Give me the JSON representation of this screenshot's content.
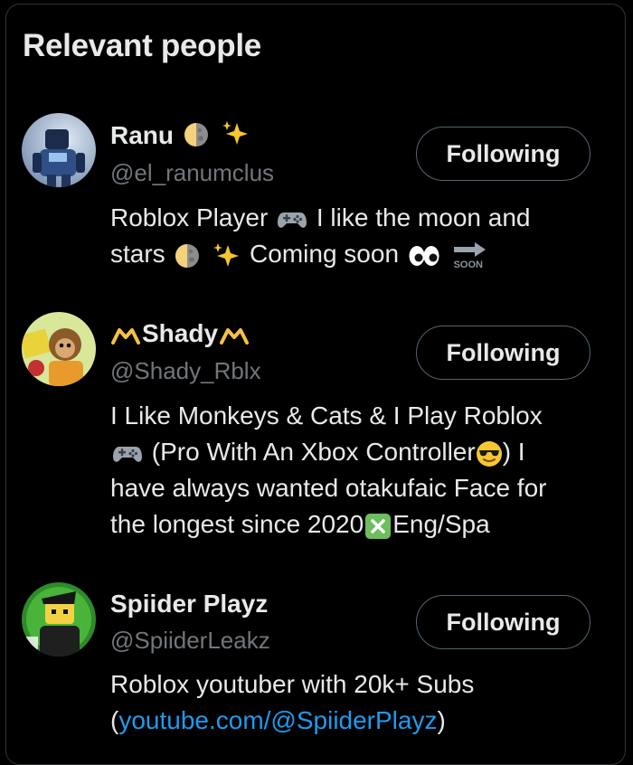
{
  "section_title": "Relevant people",
  "people": [
    {
      "name": "Ranu",
      "handle": "@el_ranumclus",
      "follow_label": "Following",
      "bio_1": "Roblox Player",
      "bio_2": "I like the moon and",
      "bio_3": "stars",
      "bio_4": "Coming soon",
      "soon_label": "SOON"
    },
    {
      "name": "Shady",
      "handle": "@Shady_Rblx",
      "follow_label": "Following",
      "bio_1": "I Like Monkeys & Cats & I Play Roblox",
      "bio_2": "(Pro With An Xbox Controller",
      "bio_3": ") I",
      "bio_4": "have always wanted otakufaic Face for",
      "bio_5": "the longest since 2020",
      "bio_6": "Eng/Spa"
    },
    {
      "name": "Spiider Playz",
      "handle": "@SpiiderLeakz",
      "follow_label": "Following",
      "bio_1": "Roblox youtuber with 20k+ Subs",
      "bio_2": "(",
      "bio_link": "youtube.com/@SpiiderPlayz",
      "bio_3": ")"
    }
  ],
  "colors": {
    "background": "#000000",
    "text": "#e7e9ea",
    "secondary": "#71767b",
    "link": "#1d9bf0",
    "border": "#536471"
  }
}
